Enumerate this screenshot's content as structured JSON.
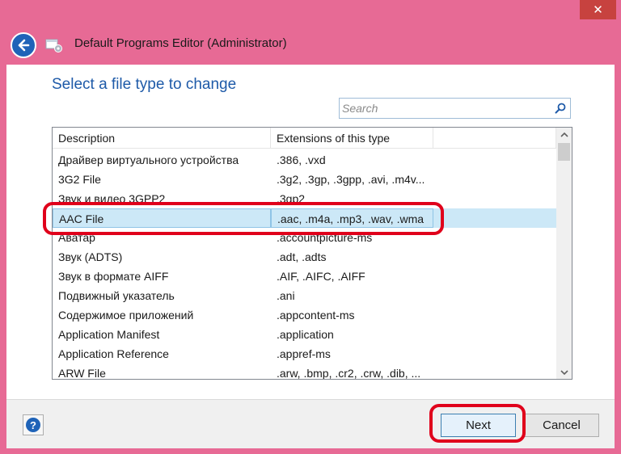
{
  "window": {
    "title": "Default Programs Editor (Administrator)",
    "close_glyph": "✕",
    "accent": "#e76a95"
  },
  "page": {
    "heading": "Select a file type to change"
  },
  "search": {
    "placeholder": "Search",
    "value": ""
  },
  "list": {
    "columns": [
      "Description",
      "Extensions of this type"
    ],
    "rows": [
      {
        "description": "Драйвер виртуального устройства",
        "extensions": ".386, .vxd"
      },
      {
        "description": "3G2 File",
        "extensions": ".3g2, .3gp, .3gpp, .avi, .m4v..."
      },
      {
        "description": "Звук и видео 3GPP2",
        "extensions": ".3gp2"
      },
      {
        "description": "AAC File",
        "extensions": ".aac, .m4a, .mp3, .wav, .wma",
        "selected": true
      },
      {
        "description": "Аватар",
        "extensions": ".accountpicture-ms"
      },
      {
        "description": "Звук (ADTS)",
        "extensions": ".adt, .adts"
      },
      {
        "description": "Звук в формате AIFF",
        "extensions": ".AIF, .AIFC, .AIFF"
      },
      {
        "description": "Подвижный указатель",
        "extensions": ".ani"
      },
      {
        "description": "Содержимое приложений",
        "extensions": ".appcontent-ms"
      },
      {
        "description": "Application Manifest",
        "extensions": ".application"
      },
      {
        "description": "Application Reference",
        "extensions": ".appref-ms"
      },
      {
        "description": "ARW File",
        "extensions": ".arw, .bmp, .cr2, .crw, .dib, ..."
      }
    ]
  },
  "footer": {
    "help_glyph": "?",
    "next_label": "Next",
    "cancel_label": "Cancel"
  },
  "annotation_color": "#e0001b"
}
